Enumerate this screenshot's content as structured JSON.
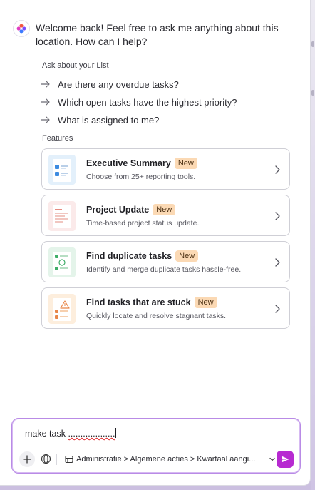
{
  "assistant": {
    "welcome": "Welcome back! Feel free to ask me anything about this location. How can I help?"
  },
  "ask": {
    "label": "Ask about your List",
    "suggestions": [
      "Are there any overdue tasks?",
      "Which open tasks have the highest priority?",
      "What is assigned to me?"
    ]
  },
  "features": {
    "label": "Features",
    "cards": [
      {
        "title": "Executive Summary",
        "badge": "New",
        "description": "Choose from 25+ reporting tools.",
        "icon": "report-thumbnail-icon"
      },
      {
        "title": "Project Update",
        "badge": "New",
        "description": "Time-based project status update.",
        "icon": "document-thumbnail-icon"
      },
      {
        "title": "Find duplicate tasks",
        "badge": "New",
        "description": "Identify and merge duplicate tasks hassle-free.",
        "icon": "duplicate-thumbnail-icon"
      },
      {
        "title": "Find tasks that are stuck",
        "badge": "New",
        "description": "Quickly locate and resolve stagnant tasks.",
        "icon": "warning-thumbnail-icon"
      }
    ]
  },
  "composer": {
    "text_plain": "make task ",
    "text_misspelled": "...................",
    "location": "Administratie > Algemene acties > Kwartaal aangi..."
  },
  "colors": {
    "accent": "#b72ad1",
    "badge_bg": "#fbd9b4",
    "composer_border": "#b98be6"
  }
}
